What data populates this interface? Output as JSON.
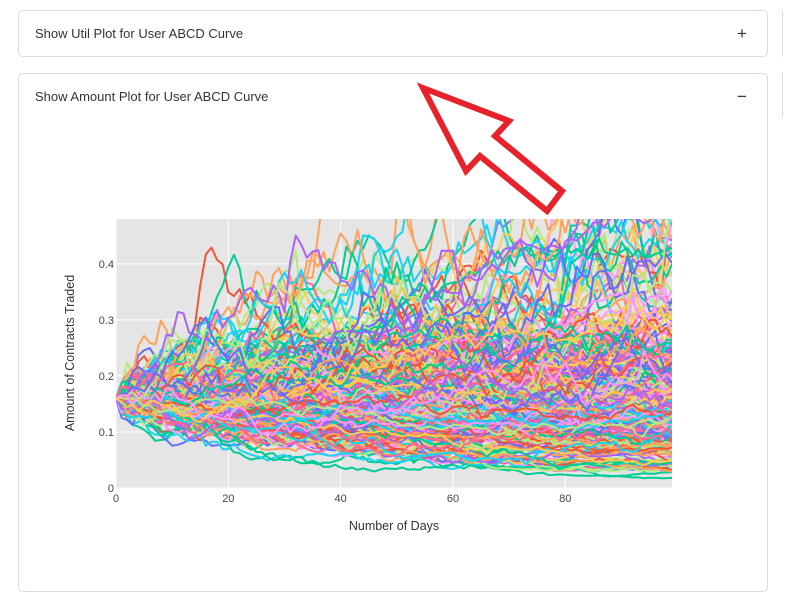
{
  "expanders": [
    {
      "title": "Show Util Plot for User ABCD Curve",
      "toggle": "+",
      "expanded": false
    },
    {
      "title": "Show Amount Plot for User ABCD Curve",
      "toggle": "−",
      "expanded": true
    }
  ],
  "chart_data": {
    "type": "line",
    "title": "",
    "xlabel": "Number of Days",
    "ylabel": "Amount of Contracts Traded",
    "xlim": [
      0,
      99
    ],
    "ylim": [
      0,
      0.48
    ],
    "x_ticks": [
      0,
      20,
      40,
      60,
      80
    ],
    "y_ticks": [
      0,
      0.1,
      0.2,
      0.3,
      0.4
    ],
    "x_tick_labels": [
      "0",
      "20",
      "40",
      "60",
      "80"
    ],
    "y_tick_labels": [
      "0",
      "0.1",
      "0.2",
      "0.3",
      "0.4"
    ],
    "grid": true,
    "background": "#e5e5e5",
    "start_value": 0.16,
    "num_series_approx": 300,
    "series_summary": "Many simulated random-walk paths starting near 0.16 at day 0 and fanning out toward roughly 0.03–0.48 by day 99",
    "legend": "none",
    "colors": [
      "#636efa",
      "#ef553b",
      "#00cc96",
      "#ab63fa",
      "#ffa15a",
      "#19d3f3",
      "#ff6692",
      "#b6e880",
      "#ff97ff",
      "#fecb52"
    ]
  },
  "annotation": {
    "type": "arrow",
    "color": "#e8222a",
    "points_to": "expander-amount-header"
  }
}
